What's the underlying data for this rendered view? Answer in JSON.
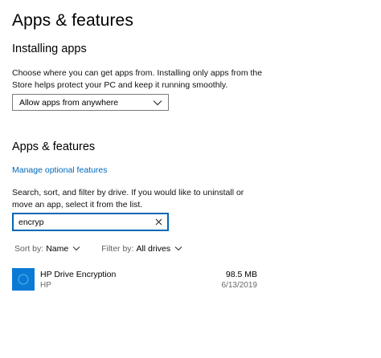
{
  "page": {
    "title": "Apps & features"
  },
  "installing": {
    "heading": "Installing apps",
    "description": "Choose where you can get apps from. Installing only apps from the Store helps protect your PC and keep it running smoothly.",
    "dropdown_value": "Allow apps from anywhere"
  },
  "apps": {
    "heading": "Apps & features",
    "manage_link": "Manage optional features",
    "description": "Search, sort, and filter by drive. If you would like to uninstall or move an app, select it from the list.",
    "search_value": "encryp",
    "sort_label": "Sort by:",
    "sort_value": "Name",
    "filter_label": "Filter by:",
    "filter_value": "All drives",
    "list": [
      {
        "name": "HP Drive Encryption",
        "publisher": "HP",
        "size": "98.5 MB",
        "date": "6/13/2019",
        "icon": "hp-drive-encryption-icon"
      }
    ]
  },
  "colors": {
    "accent": "#0067b8",
    "app_icon_bg": "#0a7ad4"
  }
}
